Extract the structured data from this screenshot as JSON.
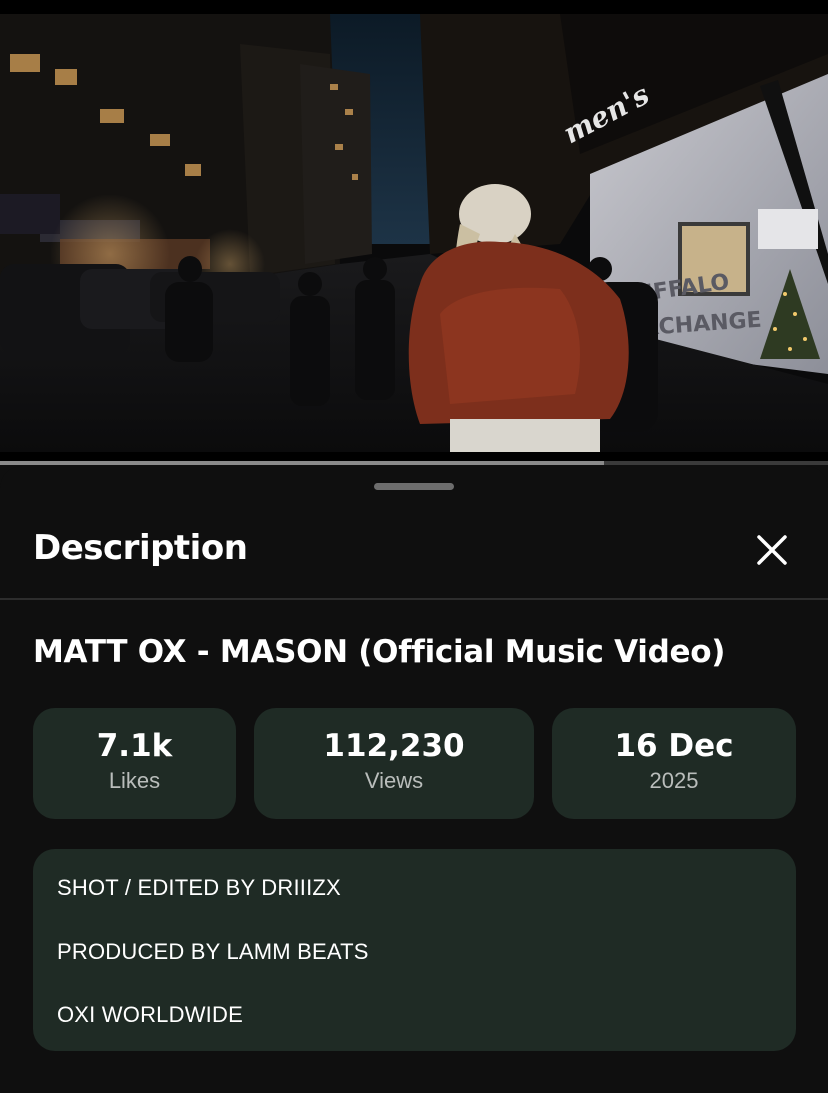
{
  "video": {
    "storefront_sign": "men's",
    "window_sign_line1": "BUFFALO",
    "window_sign_line2": "EXCHANGE",
    "progress_fraction": 0.73
  },
  "sheet": {
    "title": "Description",
    "close_icon": "close-icon"
  },
  "video_info": {
    "title": "MATT OX - MASON (Official Music Video)",
    "likes": {
      "value": "7.1k",
      "label": "Likes"
    },
    "views": {
      "value": "112,230",
      "label": "Views"
    },
    "date": {
      "value": "16 Dec",
      "label": "2025"
    }
  },
  "description": {
    "lines": [
      "SHOT / EDITED BY DRIIIZX",
      "PRODUCED BY LAMM BEATS",
      "OXI WORLDWIDE"
    ]
  },
  "colors": {
    "background": "#0f0f0f",
    "card": "#1f2b25",
    "muted_text": "#b9bdbb"
  }
}
